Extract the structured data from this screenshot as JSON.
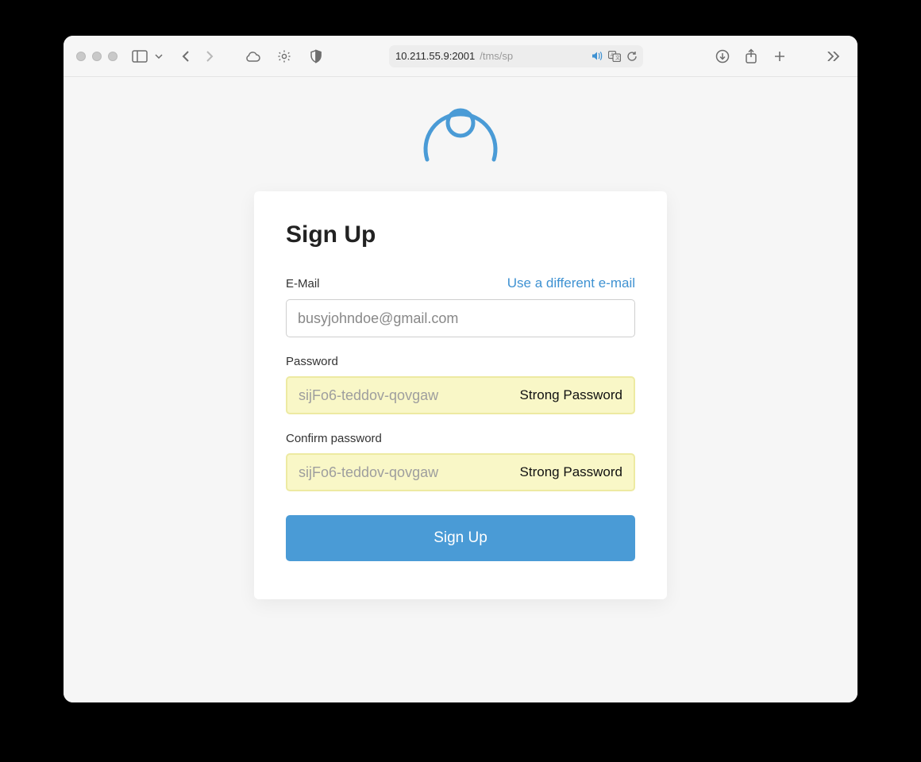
{
  "browser": {
    "url_display_host": "10.211.55.9:2001",
    "url_display_path": "/tms/sp"
  },
  "page": {
    "title": "Sign Up",
    "email": {
      "label": "E-Mail",
      "alt_link": "Use a different e-mail",
      "value": "busyjohndoe@gmail.com"
    },
    "password": {
      "label": "Password",
      "masked_value": "sijFo6-teddov-qovgaw",
      "strength_label": "Strong Password"
    },
    "confirm": {
      "label": "Confirm password",
      "masked_value": "sijFo6-teddov-qovgaw",
      "strength_label": "Strong Password"
    },
    "submit_label": "Sign Up"
  }
}
